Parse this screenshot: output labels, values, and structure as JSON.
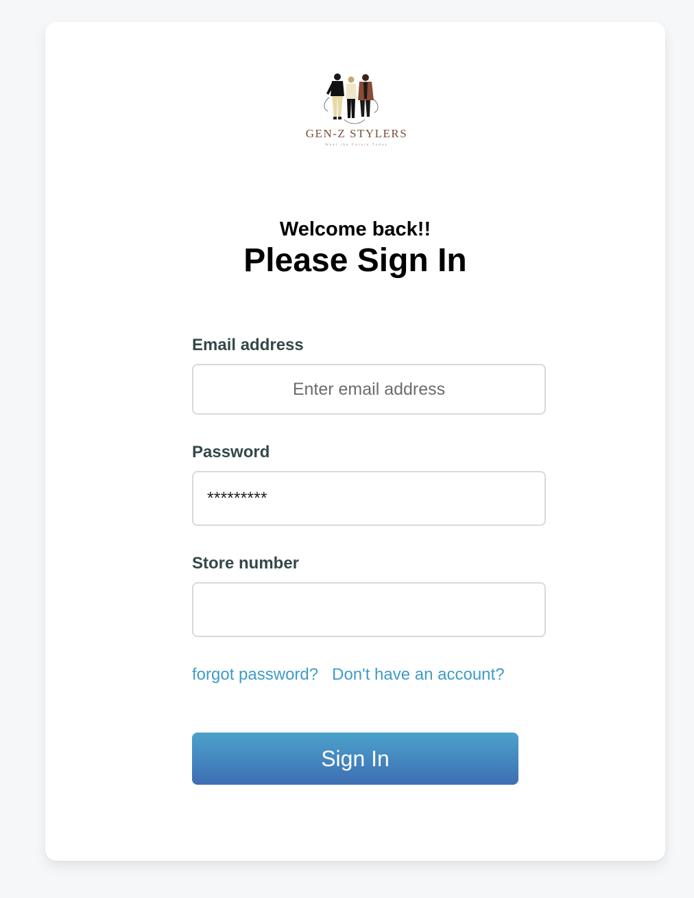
{
  "logo": {
    "brand_name": "GEN-Z STYLERS",
    "tagline": "Wear the Future,Today",
    "brand_color": "#7a4e3c"
  },
  "heading": {
    "welcome": "Welcome back!!",
    "title": "Please Sign In"
  },
  "form": {
    "email": {
      "label": "Email address",
      "placeholder": "Enter email address",
      "value": ""
    },
    "password": {
      "label": "Password",
      "value": "*********"
    },
    "store": {
      "label": "Store number",
      "value": ""
    }
  },
  "links": {
    "forgot_password": "forgot password?",
    "no_account": "Don't have an account?"
  },
  "submit": {
    "label": "Sign In"
  },
  "colors": {
    "background": "#f6f7f9",
    "label": "#34484a",
    "link": "#3e9bc8",
    "button_top": "#4ba2cc",
    "button_bottom": "#3e6eb3"
  }
}
